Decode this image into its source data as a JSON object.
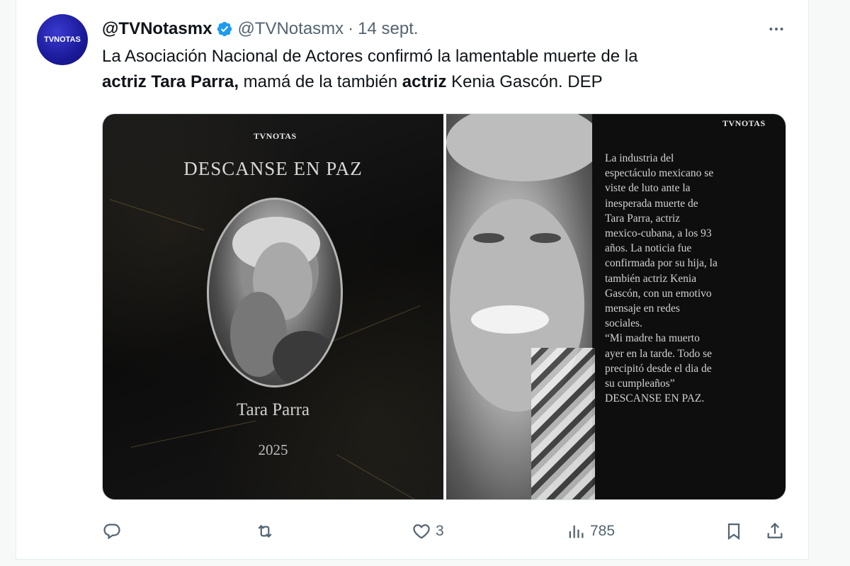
{
  "author": {
    "display_name": "@TVNotasmx",
    "handle": "@TVNotasmx",
    "separator": "·",
    "timestamp": "14 sept.",
    "avatar_text": "TVNOTAS",
    "verified_color": "#1d9bf0"
  },
  "tweet": {
    "line1": "La Asociación Nacional de Actores confirmó la lamentable muerte de la",
    "bold1": "actriz Tara Parra,",
    "mid": " mamá de la también ",
    "bold2": "actriz",
    "end": " Kenia Gascón. DEP"
  },
  "media": {
    "left": {
      "brand": "TVNOTAS",
      "title": "DESCANSE EN PAZ",
      "name": "Tara Parra",
      "year": "2025"
    },
    "right": {
      "brand": "TVNOTAS",
      "story": "La industria del\nespectáculo mexicano se\nviste de luto ante la\ninesperada muerte de\nTara Parra, actriz\nmexico-cubana, a los 93\naños. La noticia fue\nconfirmada por su hija, la\ntambién actriz Kenia\nGascón, con un emotivo\nmensaje en redes\nsociales.\n“Mi madre ha muerto\nayer en la tarde. Todo se\nprecipitó desde el dia de\nsu cumpleaños”\nDESCANSE EN PAZ."
    }
  },
  "actions": {
    "reply_icon": "reply-icon",
    "retweet_icon": "retweet-icon",
    "like_icon": "heart-icon",
    "likes": "3",
    "views_icon": "views-icon",
    "views": "785",
    "bookmark_icon": "bookmark-icon",
    "share_icon": "share-icon",
    "icon_color": "#536471"
  }
}
